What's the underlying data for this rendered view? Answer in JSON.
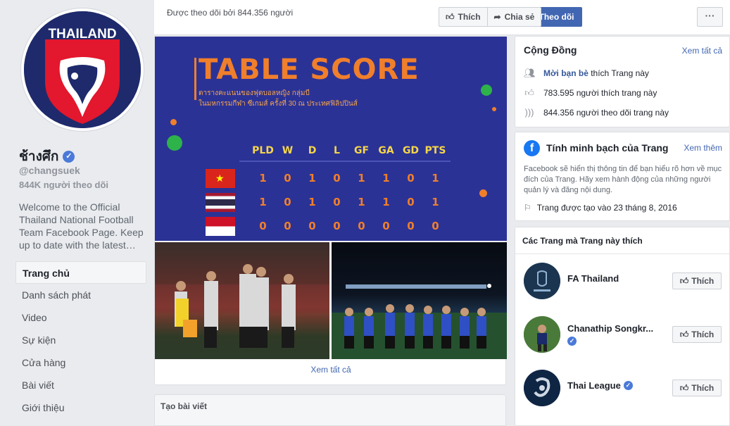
{
  "page": {
    "name": "ช้างศึก",
    "handle": "@changsuek",
    "followers_short": "844K người theo dõi",
    "about": "Welcome to the Official Thailand National Football Team Facebook Page. Keep up to date with the latest…",
    "logo_text": "THAILAND"
  },
  "nav": {
    "items": [
      {
        "label": "Trang chủ"
      },
      {
        "label": "Danh sách phát"
      },
      {
        "label": "Video"
      },
      {
        "label": "Sự kiện"
      },
      {
        "label": "Cửa hàng"
      },
      {
        "label": "Bài viết"
      },
      {
        "label": "Giới thiệu"
      }
    ]
  },
  "topbar": {
    "followed_by": "Được theo dõi bởi 844.356 người",
    "follow_label": "Theo dõi",
    "like_label": "Thích",
    "share_label": "Chia sẻ",
    "more_label": "···"
  },
  "photos": {
    "table_score": {
      "title": "TABLE SCORE",
      "subtitle_1": "ตารางคะแนนของฟุตบอลหญิง กลุ่มบี",
      "subtitle_2": "ในมหกรรมกีฬา ซีเกมส์ ครั้งที่ 30 ณ ประเทศฟิลิปปินส์",
      "headers": [
        "PLD",
        "W",
        "D",
        "L",
        "GF",
        "GA",
        "GD",
        "PTS"
      ],
      "rows": [
        {
          "team": "Vietnam",
          "values": [
            "1",
            "0",
            "1",
            "0",
            "1",
            "1",
            "0",
            "1"
          ]
        },
        {
          "team": "Thailand",
          "values": [
            "1",
            "0",
            "1",
            "0",
            "1",
            "1",
            "0",
            "1"
          ]
        },
        {
          "team": "Indonesia",
          "values": [
            "0",
            "0",
            "0",
            "0",
            "0",
            "0",
            "0",
            "0"
          ]
        }
      ]
    },
    "see_all": "Xem tất cả"
  },
  "create_post": {
    "label": "Tạo bài viết"
  },
  "community": {
    "title": "Cộng Đồng",
    "see_all": "Xem tất cả",
    "rows": [
      {
        "icon": "people-icon",
        "bold": "Mời bạn bè",
        "text": " thích Trang này"
      },
      {
        "icon": "thumbs-up-icon",
        "bold": "",
        "text": "783.595 người thích trang này"
      },
      {
        "icon": "rss-icon",
        "bold": "",
        "text": "844.356 người theo dõi trang này"
      }
    ]
  },
  "transparency": {
    "title": "Tính minh bạch của Trang",
    "see_more": "Xem thêm",
    "description": "Facebook sẽ hiển thị thông tin để bạn hiểu rõ hơn về mục đích của Trang. Hãy xem hành động của những người quản lý và đăng nội dung.",
    "created": "Trang được tạo vào 23 tháng 8, 2016"
  },
  "liked_pages": {
    "title": "Các Trang mà Trang này thích",
    "like_label": "Thích",
    "items": [
      {
        "name": "FA Thailand",
        "verified": false
      },
      {
        "name": "Chanathip Songkr...",
        "verified": true
      },
      {
        "name": "Thai League",
        "verified": true
      }
    ]
  },
  "colors": {
    "brand_blue": "#4267b2",
    "table_bg": "#2b3296",
    "table_orange": "#f07f2b"
  }
}
